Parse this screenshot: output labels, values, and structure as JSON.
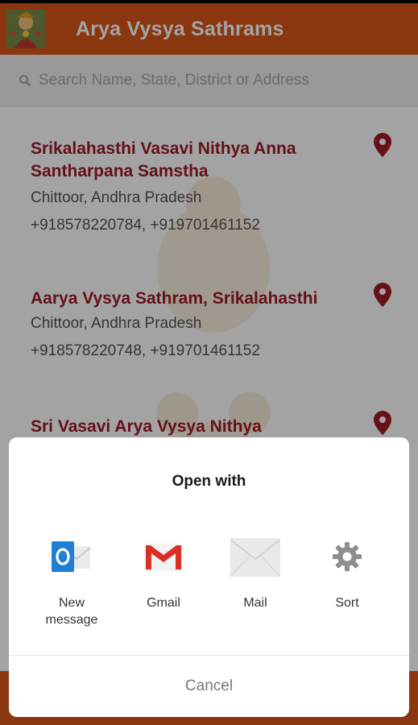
{
  "app": {
    "title": "Arya Vysya Sathrams",
    "logo_icon": "deity-logo-icon",
    "brand_color": "#d8561a",
    "accent_color": "#9e1b24"
  },
  "search": {
    "placeholder": "Search Name, State, District or Address"
  },
  "items": [
    {
      "name": "Srikalahasthi Vasavi Nithya Anna Santharpana Samstha",
      "location": "Chittoor, Andhra Pradesh",
      "phone": "+918578220784, +919701461152"
    },
    {
      "name": "Aarya Vysya Sathram, Srikalahasthi",
      "location": "Chittoor, Andhra Pradesh",
      "phone": "+918578220748, +919701461152"
    },
    {
      "name": "Sri Vasavi Arya Vysya Nithya",
      "location": "",
      "phone": ""
    }
  ],
  "dialog": {
    "title": "Open with",
    "options": [
      {
        "label": "New message",
        "icon": "outlook-icon"
      },
      {
        "label": "Gmail",
        "icon": "gmail-icon"
      },
      {
        "label": "Mail",
        "icon": "mail-icon"
      },
      {
        "label": "Sort",
        "icon": "gear-icon"
      }
    ],
    "cancel_label": "Cancel"
  }
}
